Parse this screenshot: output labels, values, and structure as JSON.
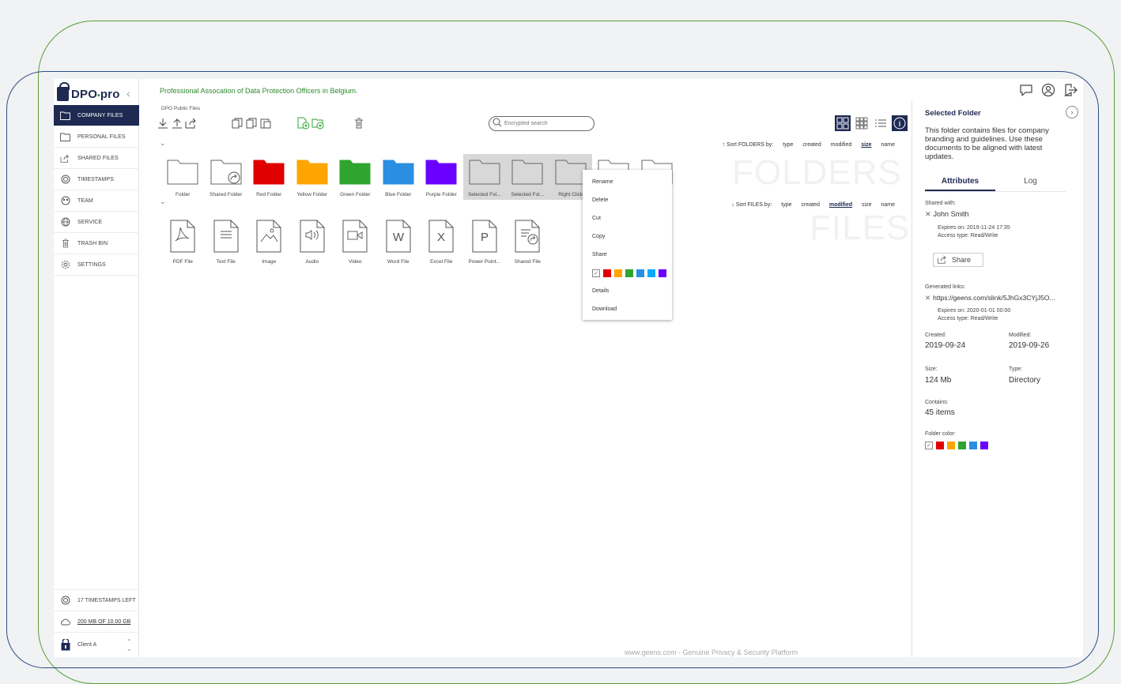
{
  "app": {
    "logo_text": "DPO",
    "logo_suffix": "pro",
    "organization": "Professional Assocation of Data Protection Officers in Belgium."
  },
  "sidebar": {
    "items": [
      {
        "label": "COMPANY FILES",
        "icon": "folder-icon",
        "active": true
      },
      {
        "label": "PERSONAL FILES",
        "icon": "folder-icon",
        "active": false
      },
      {
        "label": "SHARED FILES",
        "icon": "share-icon",
        "active": false
      },
      {
        "label": "TIMESTAMPS",
        "icon": "timestamp-icon",
        "active": false
      },
      {
        "label": "TEAM",
        "icon": "team-icon",
        "active": false
      },
      {
        "label": "SERVICE",
        "icon": "globe-icon",
        "active": false
      },
      {
        "label": "TRASH BIN",
        "icon": "trash-icon",
        "active": false
      },
      {
        "label": "SETTINGS",
        "icon": "gear-icon",
        "active": false
      }
    ],
    "timestamps_left": "17 TIMESTAMPS LEFT",
    "storage": "200 MB OF 10.00 GB",
    "client": "Client A"
  },
  "toolbar": {
    "breadcrumb": "DPO Public Files",
    "search_placeholder": "Encrypted search"
  },
  "sort_folders": {
    "label": "↑ Sort FOLDERS by:",
    "options": [
      "type",
      "created",
      "modified",
      "size",
      "name"
    ],
    "selected": "size"
  },
  "sort_files": {
    "label": "↓ Sort FILES by:",
    "options": [
      "type",
      "created",
      "modified",
      "size",
      "name"
    ],
    "selected": "modified"
  },
  "watermarks": {
    "folders": "FOLDERS",
    "files": "FILES"
  },
  "folders": [
    {
      "label": "Folder",
      "color": "#ffffff",
      "state": "normal",
      "shared": false
    },
    {
      "label": "Shared Folder",
      "color": "#ffffff",
      "state": "normal",
      "shared": true
    },
    {
      "label": "Red Folder",
      "color": "#e00000",
      "state": "normal",
      "shared": false
    },
    {
      "label": "Yellow Folder",
      "color": "#ffa500",
      "state": "normal",
      "shared": false
    },
    {
      "label": "Green Folder",
      "color": "#2fa52f",
      "state": "normal",
      "shared": false
    },
    {
      "label": "Blue Folder",
      "color": "#2a8fe0",
      "state": "normal",
      "shared": false
    },
    {
      "label": "Purple Folder",
      "color": "#6a00ff",
      "state": "normal",
      "shared": false
    },
    {
      "label": "Selected Fol...",
      "color": "#d8d8d8",
      "state": "selected",
      "shared": false
    },
    {
      "label": "Selected Fol...",
      "color": "#d8d8d8",
      "state": "selected",
      "shared": false
    },
    {
      "label": "Right Click",
      "color": "#d8d8d8",
      "state": "selected",
      "shared": false
    },
    {
      "label": "",
      "color": "#ffffff",
      "state": "normal",
      "shared": false
    },
    {
      "label": "",
      "color": "#ffffff",
      "state": "normal",
      "shared": false
    }
  ],
  "files": [
    {
      "label": "PDF File",
      "glyph": "pdf"
    },
    {
      "label": "Text File",
      "glyph": "text"
    },
    {
      "label": "Image",
      "glyph": "image"
    },
    {
      "label": "Audio",
      "glyph": "audio"
    },
    {
      "label": "Video",
      "glyph": "video"
    },
    {
      "label": "Word File",
      "glyph": "W"
    },
    {
      "label": "Excel File",
      "glyph": "X"
    },
    {
      "label": "Power Point...",
      "glyph": "P"
    },
    {
      "label": "Shared File",
      "glyph": "shared"
    }
  ],
  "context_menu": {
    "items_top": [
      "Rename",
      "Delete",
      "Cut",
      "Copy",
      "Share"
    ],
    "colors": [
      "#e00000",
      "#ffa500",
      "#2fa52f",
      "#2a8fe0",
      "#00aaff",
      "#6a00ff"
    ],
    "items_bottom": [
      "Details",
      "Download"
    ]
  },
  "panel": {
    "title": "Selected Folder",
    "description": "This folder contains files for company branding and guidelines. Use these documents to be aligned with latest updates.",
    "tabs": [
      "Attributes",
      "Log"
    ],
    "shared_with_label": "Shared with:",
    "shared_user": "John Smith",
    "shared_expires": "Expires on: 2019-11-24  17:35",
    "shared_access": "Access type: Read/Write",
    "share_button": "Share",
    "links_label": "Generated links:",
    "link_url": "https://geens.com/slink/5JhGx3CYjJ5O...",
    "link_expires": "Expires on: 2020-01-01  00:00",
    "link_access": "Access type: Read/Write",
    "created_label": "Created:",
    "created": "2019-09-24",
    "modified_label": "Modified:",
    "modified": "2019-09-26",
    "size_label": "Size:",
    "size": "124 Mb",
    "type_label": "Type:",
    "type": "Directory",
    "contains_label": "Contains:",
    "contains": "45 items",
    "folder_color_label": "Folder color:",
    "colors": [
      "#e00000",
      "#ffa500",
      "#2fa52f",
      "#2a8fe0",
      "#6a00ff"
    ]
  },
  "footer": "www.geens.com - Genuine Privacy & Security Platform"
}
